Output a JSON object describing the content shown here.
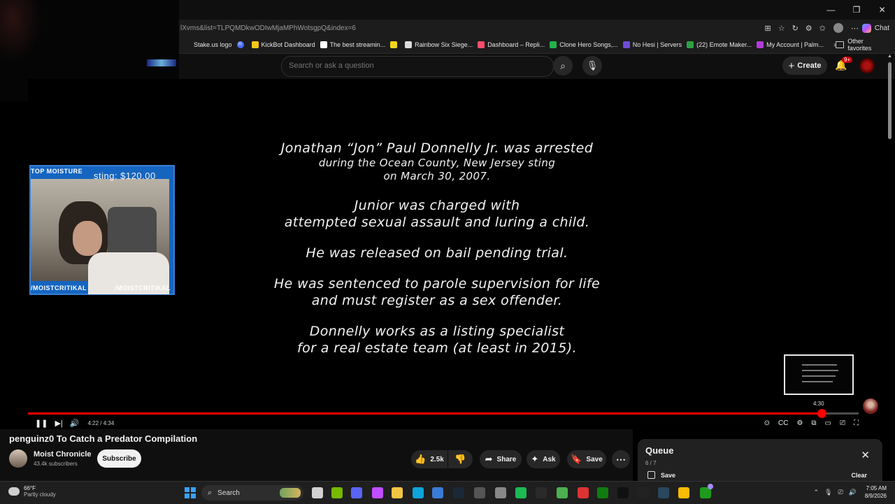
{
  "window": {
    "minimize": "—",
    "restore": "❐",
    "close": "✕"
  },
  "browser": {
    "url": "lXvms&list=TLPQMDkwODIwMjaMPhWotsgpQ&index=6",
    "chat_label": "Chat",
    "bookmarks": [
      {
        "label": "Stake.us logo",
        "color": "#1c1c1c"
      },
      {
        "label": "",
        "color": "#4a6cf7",
        "letter": "R"
      },
      {
        "label": "KickBot Dashboard",
        "color": "#f5c518"
      },
      {
        "label": "The best streamin...",
        "color": "#ffffff"
      },
      {
        "label": "",
        "color": "#f2d51a"
      },
      {
        "label": "Rainbow Six Siege...",
        "color": "#dcdcdc"
      },
      {
        "label": "Dashboard – Repli...",
        "color": "#ff4d6d"
      },
      {
        "label": "Clone Hero Songs,...",
        "color": "#22b14c"
      },
      {
        "label": "No Hesi | Servers",
        "color": "#6e4bd8"
      },
      {
        "label": "(22) Emote Maker...",
        "color": "#2ea043"
      },
      {
        "label": "My Account | Palm...",
        "color": "#b23bd9"
      }
    ],
    "other_favorites": "Other favorites"
  },
  "youtube_header": {
    "search_placeholder": "Search or ask a question",
    "create_label": "Create",
    "notification_count": "9+"
  },
  "webcam_overlay": {
    "top_label": "TOP MOISTURE",
    "goal_text": "sting: $120.00",
    "bottom_left": "/MOISTCRITIKAL",
    "bottom_right": "/MOISTCRITIKAL"
  },
  "video_caption": {
    "block1_line1": "Jonathan “Jon” Paul Donnelly Jr. was arrested",
    "block1_line2": "during the Ocean County, New Jersey sting",
    "block1_line3": "on March 30, 2007.",
    "block2_line1": "Junior was charged with",
    "block2_line2": "attempted sexual assault and luring a child.",
    "block3_line1": "He was released on bail pending trial.",
    "block4_line1": "He was sentenced to parole supervision for life",
    "block4_line2": "and must register as a sex offender.",
    "block5_line1": "Donnelly works as a listing specialist",
    "block5_line2": "for a real estate team (at least in 2015)."
  },
  "player": {
    "current_time": "4:22",
    "duration": "4:34",
    "time_display": "4:22 / 4:34",
    "hover_time": "4:30",
    "progress_fraction": 0.955,
    "accent_color": "#ff0000"
  },
  "video_info": {
    "title": "penguinz0 To Catch a Predator Compilation",
    "channel_name": "Moist Chronicle",
    "subscribers": "43.4k subscribers",
    "subscribe_label": "Subscribe",
    "like_count": "2.5k",
    "share_label": "Share",
    "ask_label": "Ask",
    "save_label": "Save"
  },
  "queue": {
    "title": "Queue",
    "position": "6 / 7",
    "save_label": "Save",
    "clear_label": "Clear"
  },
  "taskbar": {
    "temperature": "66°F",
    "weather": "Partly cloudy",
    "search_label": "Search",
    "time": "7:05 AM",
    "date": "8/9/2026"
  }
}
